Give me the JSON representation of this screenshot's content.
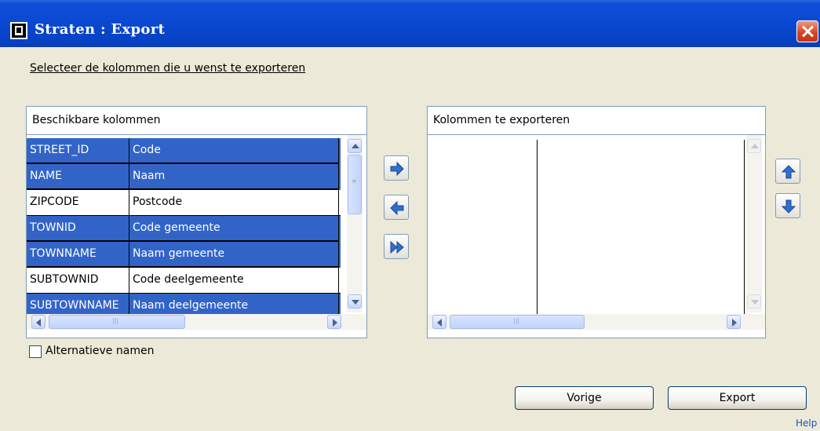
{
  "window": {
    "title": "Straten : Export"
  },
  "instruction": "Selecteer de kolommen die u wenst te exporteren",
  "available_panel": {
    "header": "Beschikbare kolommen",
    "rows": [
      {
        "name": "STREET_ID",
        "label": "Code",
        "selected": true
      },
      {
        "name": "NAME",
        "label": "Naam",
        "selected": true
      },
      {
        "name": "ZIPCODE",
        "label": "Postcode",
        "selected": false
      },
      {
        "name": "TOWNID",
        "label": "Code gemeente",
        "selected": true
      },
      {
        "name": "TOWNNAME",
        "label": "Naam gemeente",
        "selected": true
      },
      {
        "name": "SUBTOWNID",
        "label": "Code deelgemeente",
        "selected": false
      },
      {
        "name": "SUBTOWNNAME",
        "label": "Naam deelgemeente",
        "selected": true
      }
    ]
  },
  "export_panel": {
    "header": "Kolommen te exporteren",
    "rows": []
  },
  "move_buttons": [
    "arrow-right-icon",
    "arrow-left-icon",
    "double-arrow-right-icon"
  ],
  "order_buttons": [
    "arrow-up-icon",
    "arrow-down-icon"
  ],
  "checkbox": {
    "label": "Alternatieve namen",
    "checked": false
  },
  "buttons": {
    "previous": "Vorige",
    "export": "Export"
  },
  "help_link": "Help",
  "colors": {
    "title_bar": "#0A48D0",
    "selection": "#3264C8",
    "dialog_bg": "#ECE9D8",
    "icon_blue": "#2F6FD0"
  }
}
